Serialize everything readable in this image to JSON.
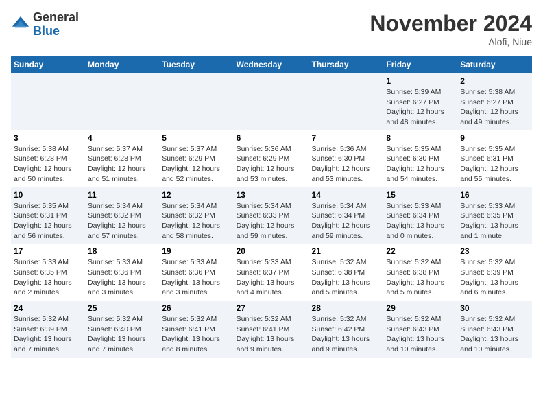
{
  "header": {
    "logo": {
      "general": "General",
      "blue": "Blue"
    },
    "title": "November 2024",
    "location": "Alofi, Niue"
  },
  "weekdays": [
    "Sunday",
    "Monday",
    "Tuesday",
    "Wednesday",
    "Thursday",
    "Friday",
    "Saturday"
  ],
  "weeks": [
    [
      {
        "day": "",
        "info": ""
      },
      {
        "day": "",
        "info": ""
      },
      {
        "day": "",
        "info": ""
      },
      {
        "day": "",
        "info": ""
      },
      {
        "day": "",
        "info": ""
      },
      {
        "day": "1",
        "info": "Sunrise: 5:39 AM\nSunset: 6:27 PM\nDaylight: 12 hours and 48 minutes."
      },
      {
        "day": "2",
        "info": "Sunrise: 5:38 AM\nSunset: 6:27 PM\nDaylight: 12 hours and 49 minutes."
      }
    ],
    [
      {
        "day": "3",
        "info": "Sunrise: 5:38 AM\nSunset: 6:28 PM\nDaylight: 12 hours and 50 minutes."
      },
      {
        "day": "4",
        "info": "Sunrise: 5:37 AM\nSunset: 6:28 PM\nDaylight: 12 hours and 51 minutes."
      },
      {
        "day": "5",
        "info": "Sunrise: 5:37 AM\nSunset: 6:29 PM\nDaylight: 12 hours and 52 minutes."
      },
      {
        "day": "6",
        "info": "Sunrise: 5:36 AM\nSunset: 6:29 PM\nDaylight: 12 hours and 53 minutes."
      },
      {
        "day": "7",
        "info": "Sunrise: 5:36 AM\nSunset: 6:30 PM\nDaylight: 12 hours and 53 minutes."
      },
      {
        "day": "8",
        "info": "Sunrise: 5:35 AM\nSunset: 6:30 PM\nDaylight: 12 hours and 54 minutes."
      },
      {
        "day": "9",
        "info": "Sunrise: 5:35 AM\nSunset: 6:31 PM\nDaylight: 12 hours and 55 minutes."
      }
    ],
    [
      {
        "day": "10",
        "info": "Sunrise: 5:35 AM\nSunset: 6:31 PM\nDaylight: 12 hours and 56 minutes."
      },
      {
        "day": "11",
        "info": "Sunrise: 5:34 AM\nSunset: 6:32 PM\nDaylight: 12 hours and 57 minutes."
      },
      {
        "day": "12",
        "info": "Sunrise: 5:34 AM\nSunset: 6:32 PM\nDaylight: 12 hours and 58 minutes."
      },
      {
        "day": "13",
        "info": "Sunrise: 5:34 AM\nSunset: 6:33 PM\nDaylight: 12 hours and 59 minutes."
      },
      {
        "day": "14",
        "info": "Sunrise: 5:34 AM\nSunset: 6:34 PM\nDaylight: 12 hours and 59 minutes."
      },
      {
        "day": "15",
        "info": "Sunrise: 5:33 AM\nSunset: 6:34 PM\nDaylight: 13 hours and 0 minutes."
      },
      {
        "day": "16",
        "info": "Sunrise: 5:33 AM\nSunset: 6:35 PM\nDaylight: 13 hours and 1 minute."
      }
    ],
    [
      {
        "day": "17",
        "info": "Sunrise: 5:33 AM\nSunset: 6:35 PM\nDaylight: 13 hours and 2 minutes."
      },
      {
        "day": "18",
        "info": "Sunrise: 5:33 AM\nSunset: 6:36 PM\nDaylight: 13 hours and 3 minutes."
      },
      {
        "day": "19",
        "info": "Sunrise: 5:33 AM\nSunset: 6:36 PM\nDaylight: 13 hours and 3 minutes."
      },
      {
        "day": "20",
        "info": "Sunrise: 5:33 AM\nSunset: 6:37 PM\nDaylight: 13 hours and 4 minutes."
      },
      {
        "day": "21",
        "info": "Sunrise: 5:32 AM\nSunset: 6:38 PM\nDaylight: 13 hours and 5 minutes."
      },
      {
        "day": "22",
        "info": "Sunrise: 5:32 AM\nSunset: 6:38 PM\nDaylight: 13 hours and 5 minutes."
      },
      {
        "day": "23",
        "info": "Sunrise: 5:32 AM\nSunset: 6:39 PM\nDaylight: 13 hours and 6 minutes."
      }
    ],
    [
      {
        "day": "24",
        "info": "Sunrise: 5:32 AM\nSunset: 6:39 PM\nDaylight: 13 hours and 7 minutes."
      },
      {
        "day": "25",
        "info": "Sunrise: 5:32 AM\nSunset: 6:40 PM\nDaylight: 13 hours and 7 minutes."
      },
      {
        "day": "26",
        "info": "Sunrise: 5:32 AM\nSunset: 6:41 PM\nDaylight: 13 hours and 8 minutes."
      },
      {
        "day": "27",
        "info": "Sunrise: 5:32 AM\nSunset: 6:41 PM\nDaylight: 13 hours and 9 minutes."
      },
      {
        "day": "28",
        "info": "Sunrise: 5:32 AM\nSunset: 6:42 PM\nDaylight: 13 hours and 9 minutes."
      },
      {
        "day": "29",
        "info": "Sunrise: 5:32 AM\nSunset: 6:43 PM\nDaylight: 13 hours and 10 minutes."
      },
      {
        "day": "30",
        "info": "Sunrise: 5:32 AM\nSunset: 6:43 PM\nDaylight: 13 hours and 10 minutes."
      }
    ]
  ]
}
